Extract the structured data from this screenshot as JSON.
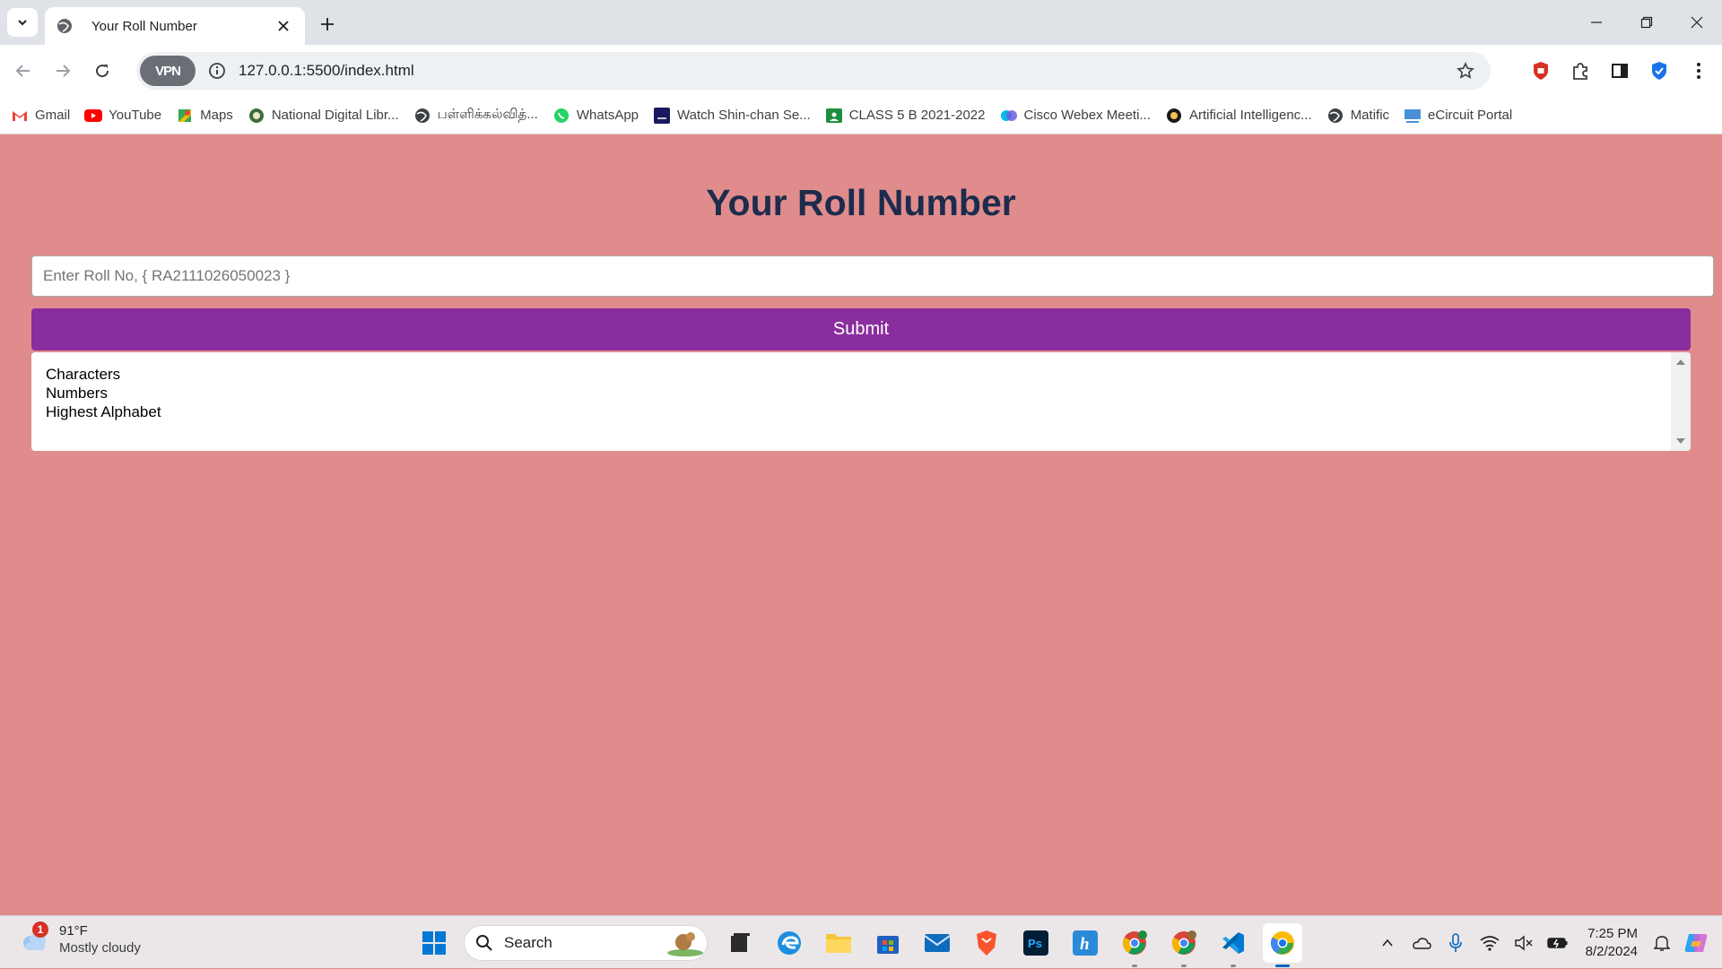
{
  "browser": {
    "tab_title": "Your Roll Number",
    "url": "127.0.0.1:5500/index.html",
    "vpn_label": "VPN"
  },
  "bookmarks": [
    {
      "label": "Gmail",
      "icon": "gmail-icon"
    },
    {
      "label": "YouTube",
      "icon": "youtube-icon"
    },
    {
      "label": "Maps",
      "icon": "maps-icon"
    },
    {
      "label": "National Digital Libr...",
      "icon": "ndl-icon"
    },
    {
      "label": "பள்ளிக்கல்வித்...",
      "icon": "globe-icon"
    },
    {
      "label": "WhatsApp",
      "icon": "whatsapp-icon"
    },
    {
      "label": "Watch Shin-chan Se...",
      "icon": "video-icon"
    },
    {
      "label": "CLASS 5 B 2021-2022",
      "icon": "classroom-icon"
    },
    {
      "label": "Cisco Webex Meeti...",
      "icon": "webex-icon"
    },
    {
      "label": "Artificial Intelligenc...",
      "icon": "ai-icon"
    },
    {
      "label": "Matific",
      "icon": "globe-icon"
    },
    {
      "label": "eCircuit Portal",
      "icon": "ecircuit-icon"
    }
  ],
  "page": {
    "title": "Your Roll Number",
    "input_placeholder": "Enter Roll No, { RA2111026050023 }",
    "submit_label": "Submit",
    "results": [
      "Characters",
      "Numbers",
      "Highest Alphabet"
    ]
  },
  "taskbar": {
    "weather_badge": "1",
    "temperature": "91°F",
    "condition": "Mostly cloudy",
    "search_label": "Search",
    "time": "7:25 PM",
    "date": "8/2/2024"
  },
  "colors": {
    "page_bg": "#e08c8c",
    "title": "#1d2c4d",
    "submit_bg": "#8a2d9e"
  }
}
